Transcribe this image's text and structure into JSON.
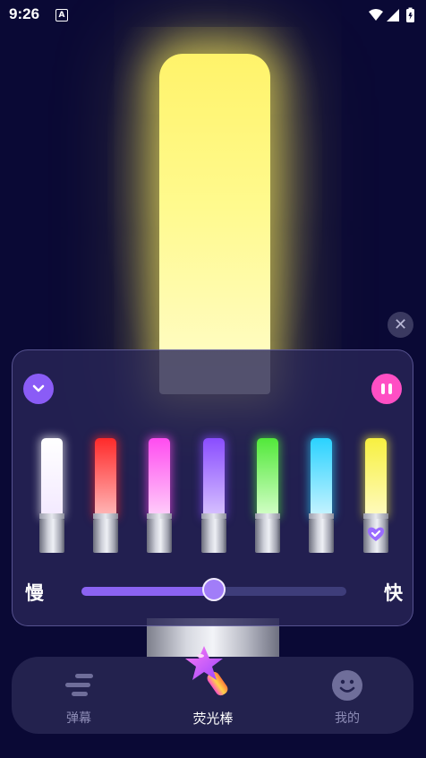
{
  "status_bar": {
    "time": "9:26",
    "notification_glyph": "A"
  },
  "glow_stick": {
    "color": "#fff36a"
  },
  "panel": {
    "colors": [
      {
        "name": "white",
        "top": "#ffffff",
        "bottom": "#f3e9ff"
      },
      {
        "name": "red",
        "top": "#ff2a2a",
        "bottom": "#ffb9b9"
      },
      {
        "name": "pink",
        "top": "#ff4cf0",
        "bottom": "#ffd0fa"
      },
      {
        "name": "purple",
        "top": "#8a4dff",
        "bottom": "#d8c3ff"
      },
      {
        "name": "green",
        "top": "#52e83a",
        "bottom": "#d5ffc9"
      },
      {
        "name": "cyan",
        "top": "#2ad2ff",
        "bottom": "#c9f4ff"
      },
      {
        "name": "yellow",
        "top": "#f7f040",
        "bottom": "#fffbc0"
      }
    ],
    "selected_color": "yellow",
    "speed": {
      "slow_label": "慢",
      "fast_label": "快",
      "value": 0.5
    }
  },
  "nav": {
    "items": [
      {
        "label": "弹幕",
        "icon": "danmaku-icon"
      },
      {
        "label": "荧光棒",
        "icon": "glowstick-star-icon"
      },
      {
        "label": "我的",
        "icon": "smile-face-icon"
      }
    ],
    "active": 1
  }
}
